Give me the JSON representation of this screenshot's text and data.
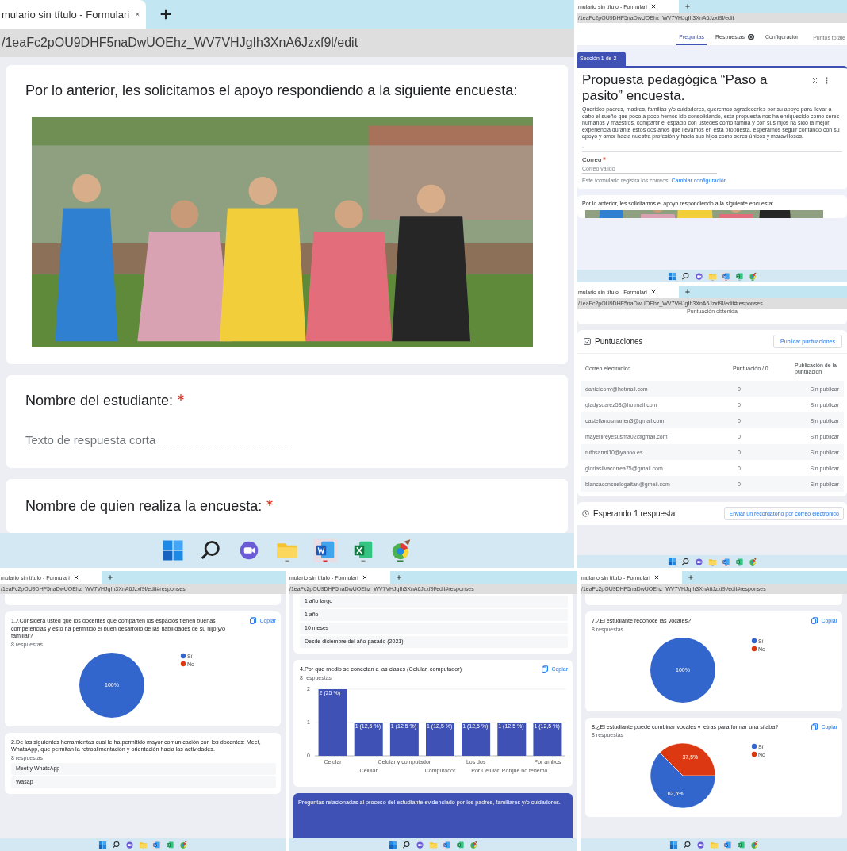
{
  "panels": [
    {
      "kind": "form_view",
      "tab_title": "mulario sin título - Formulari",
      "address": "/1eaFc2pOU9DHF5naDwUOEhz_WV7VHJgIh3XnA6Jzxf9l/edit",
      "cards": [
        {
          "kind": "text_image",
          "text": "Por lo anterior, les solicitamos el apoyo respondiendo a la siguiente encuesta:",
          "image": {
            "kind": "picture"
          }
        },
        {
          "kind": "short_question",
          "title": "Nombre del estudiante:",
          "required": true,
          "placeholder": "Texto de respuesta corta"
        },
        {
          "kind": "short_question",
          "title": "Nombre de quien realiza la encuesta:",
          "required": true
        }
      ]
    },
    {
      "kind": "form_editor",
      "tab_title": "mulario sin título - Formulari",
      "address": "/1eaFc2pOU9DHF5naDwUOEhz_WV7VHJgIh3XnA6Jzxf9l/edit",
      "nav": [
        {
          "label": "Preguntas",
          "selected": true
        },
        {
          "label": "Respuestas",
          "badge": "0",
          "selected": false
        },
        {
          "label": "Configuración",
          "selected": false
        }
      ],
      "total_points": "Puntos totale",
      "section_tab": "Sección 1 de 2",
      "form_title": "Propuesta pedagógica “Paso a pasito” encuesta.",
      "description": "Queridos padres, madres, familias y/o cuidadores, queremos agradecerles por su apoyo para llevar a cabo el sueño que poco a poco hemos ido consolidando, esta propuesta nos ha enriquecido como seres humanos y maestros, compartir el espacio con ustedes como familia y con sus hijos ha sido la mejor experiencia durante estos dos años que llevamos en esta propuesta, esperamos seguir contando con su apoyo y amor hacia nuestra profesión y hacia sus hijos como seres únicos y maravillosos.",
      "description_extra": ".",
      "email_field": {
        "label": "Correo",
        "required": true,
        "placeholder": "Correo válido"
      },
      "email_note": "Este formulario registra los correos.",
      "email_link": "Cambiar configuración",
      "next_text": "Por lo anterior, les solicitamos el apoyo respondiendo a la siguiente encuesta:",
      "image": {
        "kind": "picture"
      }
    },
    {
      "kind": "scores",
      "tab_title": "mulario sin título - Formulari",
      "address": "/1eaFc2pOU9DHF5naDwUOEhz_WV7VHJgIh3XnA6Jzxf9l/edit#responses",
      "top_text": "Puntuación obtenida",
      "heading": "Puntuaciones",
      "publish_button": "Publicar puntuaciones",
      "columns": [
        "Correo electrónico",
        "Puntuación / 0",
        "Publicación de la puntuación"
      ],
      "rows": [
        {
          "email": "danieleonv@hotmail.com",
          "score": "0",
          "status": "Sin publicar"
        },
        {
          "email": "gladysuarez58@hotmail.com",
          "score": "0",
          "status": "Sin publicar"
        },
        {
          "email": "castellanosmarlen3@gmail.com",
          "score": "0",
          "status": "Sin publicar"
        },
        {
          "email": "mayerlireyesusma02@gmail.com",
          "score": "0",
          "status": "Sin publicar"
        },
        {
          "email": "ruthsarmi10@yahoo.es",
          "score": "0",
          "status": "Sin publicar"
        },
        {
          "email": "gloriasilvacorrea75@gmail.com",
          "score": "0",
          "status": "Sin publicar"
        },
        {
          "email": "blancaconsuelogaitan@gmail.com",
          "score": "0",
          "status": "Sin publicar"
        }
      ],
      "waiting": "Esperando 1 respuesta",
      "remind_button": "Enviar un recordatorio por correo electrónico"
    },
    {
      "kind": "responses",
      "tab_title": "mulario sin título - Formulari",
      "address": "/1eaFc2pOU9DHF5naDwUOEhz_WV7VHJgIh3XnA6Jzxf9l/edit#responses",
      "cards": [
        {
          "kind": "blank"
        },
        {
          "kind": "chart_question",
          "title": "1.¿Considera usted que los docentes que comparten los espacios tienen buenas competencias y esto ha permitido el buen desarrollo de las habilidades de su hijo y/o familiar?",
          "count": "8 respuestas",
          "copy_label": "Copiar",
          "chart_data": {
            "type": "pie",
            "categories": [
              "Sí",
              "No"
            ],
            "colors": [
              "#3366cc",
              "#dc3912"
            ],
            "series": [
              {
                "values": [
                  100,
                  0
                ]
              }
            ],
            "value_labels": [
              "100%",
              null
            ],
            "legend": "right"
          }
        },
        {
          "kind": "answer_list",
          "title": "2.De las siguientes herramientas cual le ha permitido mayor comunicación con los docentes: Meet, WhatsApp, que permitan la retroalimentación y orientación hacia las actividades.",
          "count": "8 respuestas",
          "answers": [
            "Meet y WhatsApp",
            "Wasap"
          ]
        }
      ]
    },
    {
      "kind": "responses",
      "tab_title": "mulario sin título - Formulari",
      "address": "/1eaFc2pOU9DHF5naDwUOEhz_WV7VHJgIh3XnA6Jzxf9l/edit#responses",
      "cards": [
        {
          "kind": "answer_list",
          "answers": [
            "1 año largo",
            "1 año",
            "10 meses",
            "Desde diciembre del año pasado (2021)"
          ]
        },
        {
          "kind": "chart_question",
          "title": "4.Por que medio se conectan a las clases (Celular, computador)",
          "count": "8 respuestas",
          "copy_label": "Copiar",
          "chart_data": {
            "type": "bar",
            "categories": [
              "Celular",
              "Celular",
              "Celular y computador",
              "Computador",
              "Los dos",
              "Por Celular. Porque no tenemo...",
              "Por ambos"
            ],
            "colors": [
              "#3f51b5"
            ],
            "series": [
              {
                "values": [
                  2,
                  1,
                  1,
                  1,
                  1,
                  1,
                  1
                ]
              }
            ],
            "ylim": [
              0,
              2
            ],
            "yticks": [
              0,
              1,
              2
            ],
            "value_labels": [
              "2 (25 %)",
              "1 (12,5 %)",
              "1 (12,5 %)",
              "1 (12,5 %)",
              "1 (12,5 %)",
              "1 (12,5 %)",
              "1 (12,5 %)"
            ]
          }
        },
        {
          "kind": "section_header",
          "text": "Preguntas relacionadas al proceso del estudiante evidenciado por los padres, familiares y/o cuidadores."
        }
      ]
    },
    {
      "kind": "responses",
      "tab_title": "mulario sin título - Formulari",
      "address": "/1eaFc2pOU9DHF5naDwUOEhz_WV7VHJgIh3XnA6Jzxf9l/edit#responses",
      "cards": [
        {
          "kind": "blank"
        },
        {
          "kind": "chart_question",
          "title": "7.¿El estudiante reconoce las vocales?",
          "count": "8 respuestas",
          "copy_label": "Copiar",
          "chart_data": {
            "type": "pie",
            "categories": [
              "Sí",
              "No"
            ],
            "colors": [
              "#3366cc",
              "#dc3912"
            ],
            "series": [
              {
                "values": [
                  100,
                  0
                ]
              }
            ],
            "value_labels": [
              "100%",
              null
            ],
            "legend": "right"
          }
        },
        {
          "kind": "chart_question",
          "title": "8.¿El estudiante puede combinar vocales y letras para formar una sílaba?",
          "count": "8 respuestas",
          "copy_label": "Copiar",
          "chart_data": {
            "type": "pie",
            "categories": [
              "Sí",
              "No"
            ],
            "colors": [
              "#3366cc",
              "#dc3912"
            ],
            "series": [
              {
                "values": [
                  62.5,
                  37.5
                ]
              }
            ],
            "value_labels": [
              "62,5%",
              "37,5%"
            ],
            "legend": "right"
          }
        }
      ]
    }
  ]
}
